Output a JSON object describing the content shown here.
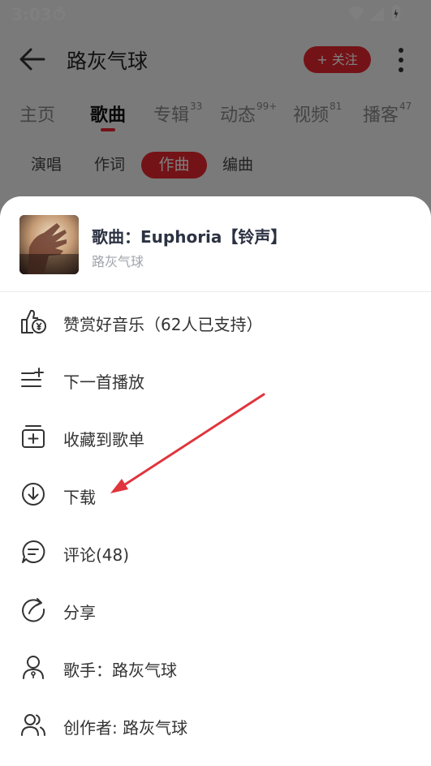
{
  "status_bar": {
    "time": "3:03"
  },
  "app_bar": {
    "title": "路灰气球",
    "follow_label": "+ 关注"
  },
  "tabs": [
    {
      "label": "主页",
      "count": ""
    },
    {
      "label": "歌曲",
      "count": ""
    },
    {
      "label": "专辑",
      "count": "33"
    },
    {
      "label": "动态",
      "count": "99+"
    },
    {
      "label": "视频",
      "count": "81"
    },
    {
      "label": "播客",
      "count": "47"
    }
  ],
  "active_tab": "歌曲",
  "chips": [
    "演唱",
    "作词",
    "作曲",
    "编曲"
  ],
  "active_chip": "作曲",
  "sheet": {
    "song_title": "歌曲：Euphoria【铃声】",
    "song_artist": "路灰气球",
    "menu": [
      {
        "label": "赞赏好音乐（62人已支持）",
        "icon": "thumbs-up-yuan-icon"
      },
      {
        "label": "下一首播放",
        "icon": "play-next-icon"
      },
      {
        "label": "收藏到歌单",
        "icon": "add-to-playlist-icon"
      },
      {
        "label": "下载",
        "icon": "download-icon"
      },
      {
        "label": "评论(48)",
        "icon": "comment-icon"
      },
      {
        "label": "分享",
        "icon": "share-icon"
      },
      {
        "label": "歌手：路灰气球",
        "icon": "singer-icon"
      },
      {
        "label": "创作者: 路灰气球",
        "icon": "creators-icon"
      }
    ]
  },
  "colors": {
    "accent": "#e8262e",
    "annotation_arrow": "#e0353d"
  }
}
